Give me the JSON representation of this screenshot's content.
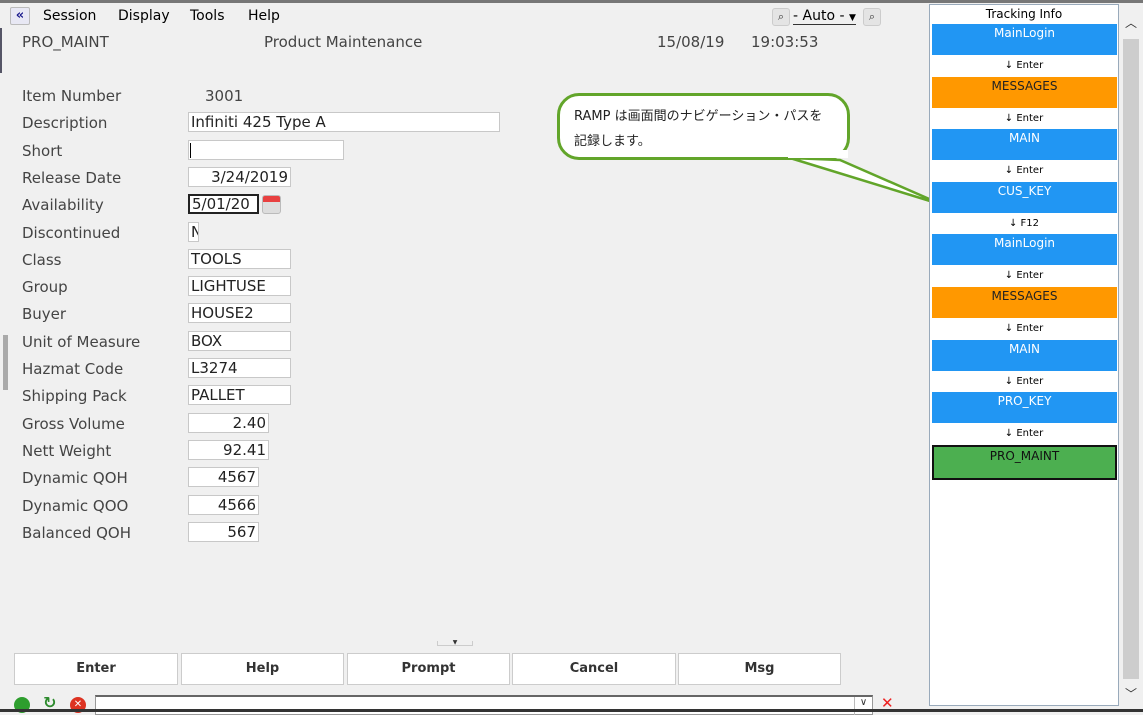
{
  "menu": {
    "items": [
      "Session",
      "Display",
      "Tools",
      "Help"
    ],
    "zoom_mode": "- Auto -"
  },
  "header": {
    "screen_id": "PRO_MAINT",
    "title": "Product Maintenance",
    "date": "15/08/19",
    "time": "19:03:53"
  },
  "form": {
    "fields": [
      {
        "label": "Item Number",
        "value": "3001"
      },
      {
        "label": "Description",
        "value": "Infiniti 425 Type A"
      },
      {
        "label": "Short",
        "value": ""
      },
      {
        "label": "Release Date",
        "value": "3/24/2019"
      },
      {
        "label": "Availability",
        "value": "5/01/20"
      },
      {
        "label": "Discontinued",
        "value": "N"
      },
      {
        "label": "Class",
        "value": "TOOLS"
      },
      {
        "label": "Group",
        "value": "LIGHTUSE"
      },
      {
        "label": "Buyer",
        "value": "HOUSE2"
      },
      {
        "label": "Unit of Measure",
        "value": "BOX"
      },
      {
        "label": "Hazmat Code",
        "value": "L3274"
      },
      {
        "label": "Shipping Pack",
        "value": "PALLET"
      },
      {
        "label": "Gross Volume",
        "value": "2.40"
      },
      {
        "label": "Nett Weight",
        "value": "92.41"
      },
      {
        "label": "Dynamic QOH",
        "value": "4567"
      },
      {
        "label": "Dynamic QOO",
        "value": "4566"
      },
      {
        "label": "Balanced QOH",
        "value": "567"
      }
    ]
  },
  "callout": {
    "text": "RAMP は画面間のナビゲーション・パスを記録します。"
  },
  "tracking": {
    "title": "Tracking Info",
    "items": [
      {
        "name": "MainLogin",
        "color": "#2196f3",
        "key": "Enter"
      },
      {
        "name": "MESSAGES",
        "color": "#ff9800",
        "key": "Enter"
      },
      {
        "name": "MAIN",
        "color": "#2196f3",
        "key": "Enter"
      },
      {
        "name": "CUS_KEY",
        "color": "#2196f3",
        "key": "F12"
      },
      {
        "name": "MainLogin",
        "color": "#2196f3",
        "key": "Enter"
      },
      {
        "name": "MESSAGES",
        "color": "#ff9800",
        "key": "Enter"
      },
      {
        "name": "MAIN",
        "color": "#2196f3",
        "key": "Enter"
      },
      {
        "name": "PRO_KEY",
        "color": "#2196f3",
        "key": "Enter"
      },
      {
        "name": "PRO_MAINT",
        "color": "#4caf50",
        "key": ""
      }
    ]
  },
  "buttons": [
    "Enter",
    "Help",
    "Prompt",
    "Cancel",
    "Msg"
  ],
  "statusbar": {
    "command_value": ""
  }
}
